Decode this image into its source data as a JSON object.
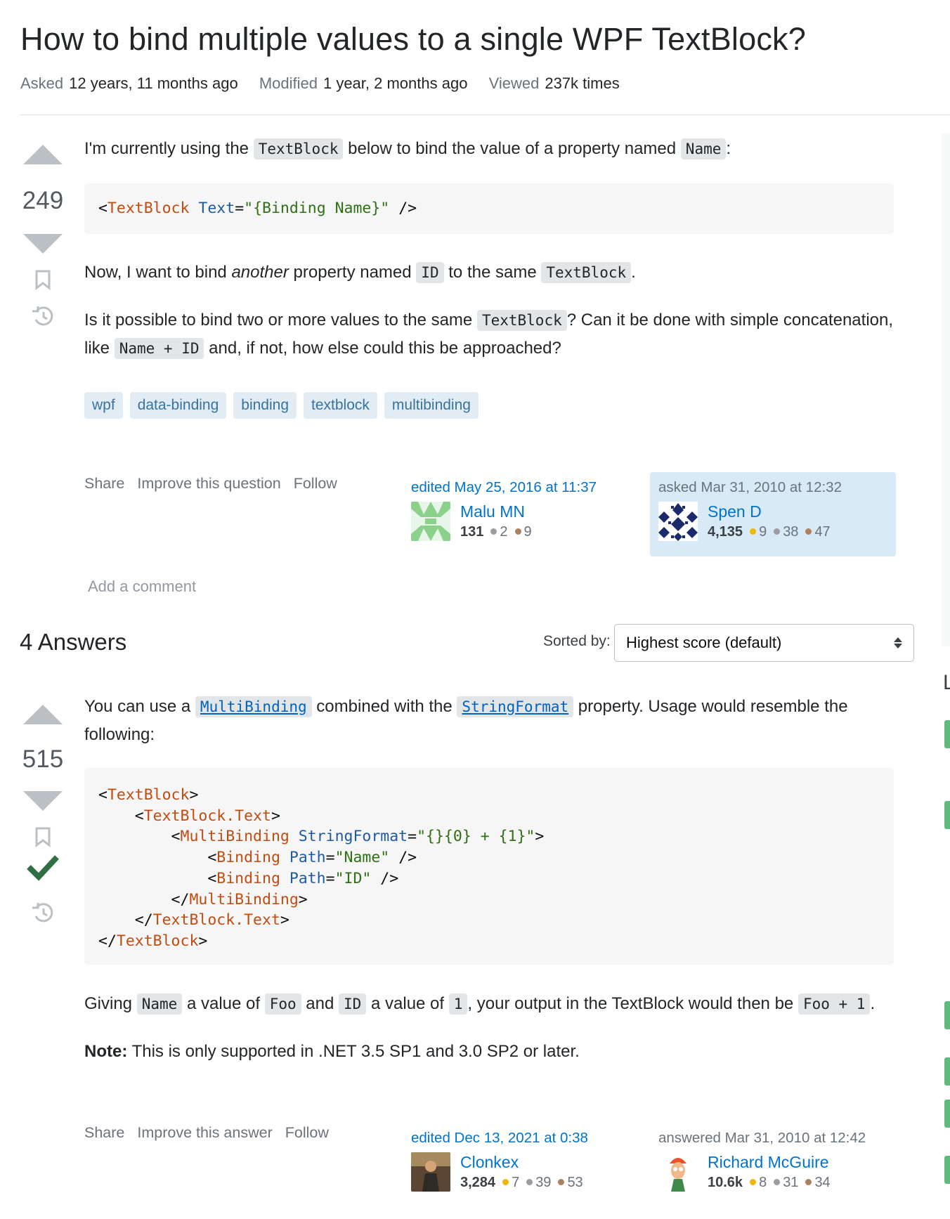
{
  "question": {
    "title": "How to bind multiple values to a single WPF TextBlock?",
    "meta": {
      "asked_label": "Asked",
      "asked_value": "12 years, 11 months ago",
      "modified_label": "Modified",
      "modified_value": "1 year, 2 months ago",
      "viewed_label": "Viewed",
      "viewed_value": "237k times"
    },
    "score": "249",
    "body": {
      "p1_a": "I'm currently using the ",
      "p1_code1": "TextBlock",
      "p1_b": " below to bind the value of a property named ",
      "p1_code2": "Name",
      "p1_c": ":",
      "code_tag": "TextBlock",
      "code_attr": "Text",
      "code_eq": "=",
      "code_str": "\"{Binding Name}\"",
      "code_open": "<",
      "code_close": " />",
      "p2_a": "Now, I want to bind ",
      "p2_em": "another",
      "p2_b": " property named ",
      "p2_code1": "ID",
      "p2_c": " to the same ",
      "p2_code2": "TextBlock",
      "p2_d": ".",
      "p3_a": "Is it possible to bind two or more values to the same ",
      "p3_code1": "TextBlock",
      "p3_b": "? Can it be done with simple concatenation, like ",
      "p3_code2": "Name + ID",
      "p3_c": " and, if not, how else could this be approached?"
    },
    "tags": [
      "wpf",
      "data-binding",
      "binding",
      "textblock",
      "multibinding"
    ],
    "actions": {
      "share": "Share",
      "improve": "Improve this question",
      "follow": "Follow"
    },
    "editor": {
      "when": "edited May 25, 2016 at 11:37",
      "name": "Malu MN",
      "rep": "131",
      "silver": "2",
      "bronze": "9"
    },
    "owner": {
      "when": "asked Mar 31, 2010 at 12:32",
      "name": "Spen D",
      "rep": "4,135",
      "gold": "9",
      "silver": "38",
      "bronze": "47"
    },
    "add_comment": "Add a comment"
  },
  "answers_header": {
    "count_label": "4 Answers",
    "sorted_label": "Sorted by:",
    "sort_value": "Highest score (default)"
  },
  "answer": {
    "score": "515",
    "p1_a": "You can use a ",
    "p1_link1": "MultiBinding",
    "p1_b": " combined with the ",
    "p1_link2": "StringFormat",
    "p1_c": " property. Usage would resemble the following:",
    "code": {
      "l1_tag": "TextBlock",
      "l2_tag": "TextBlock.Text",
      "l3_tag": "MultiBinding",
      "l3_attr": "StringFormat",
      "l3_str": "\"{}{0} + {1}\"",
      "l4_tag": "Binding",
      "l4_attr": "Path",
      "l4_str": "\"Name\"",
      "l5_tag": "Binding",
      "l5_attr": "Path",
      "l5_str": "\"ID\"",
      "l6_tag": "MultiBinding",
      "l7_tag": "TextBlock.Text",
      "l8_tag": "TextBlock"
    },
    "p2_a": "Giving ",
    "p2_c1": "Name",
    "p2_b": " a value of ",
    "p2_c2": "Foo",
    "p2_c": " and ",
    "p2_c3": "ID",
    "p2_d": " a value of ",
    "p2_c4": "1",
    "p2_e": ", your output in the TextBlock would then be ",
    "p2_c5": "Foo + 1",
    "p2_f": ".",
    "note_label": "Note:",
    "note_text": " This is only supported in .NET 3.5 SP1 and 3.0 SP2 or later.",
    "actions": {
      "share": "Share",
      "improve": "Improve this answer",
      "follow": "Follow"
    },
    "editor": {
      "when": "edited Dec 13, 2021 at 0:38",
      "name": "Clonkex",
      "rep": "3,284",
      "gold": "7",
      "silver": "39",
      "bronze": "53"
    },
    "owner": {
      "when": "answered Mar 31, 2010 at 12:42",
      "name": "Richard McGuire",
      "rep": "10.6k",
      "gold": "8",
      "silver": "31",
      "bronze": "34"
    }
  },
  "sidebar_fragment": "L",
  "colors": {
    "accent_link": "#0074cc",
    "tag_bg": "#e1ecf4",
    "accepted": "#2f6f44",
    "owner_bg": "#d9eaf7"
  }
}
